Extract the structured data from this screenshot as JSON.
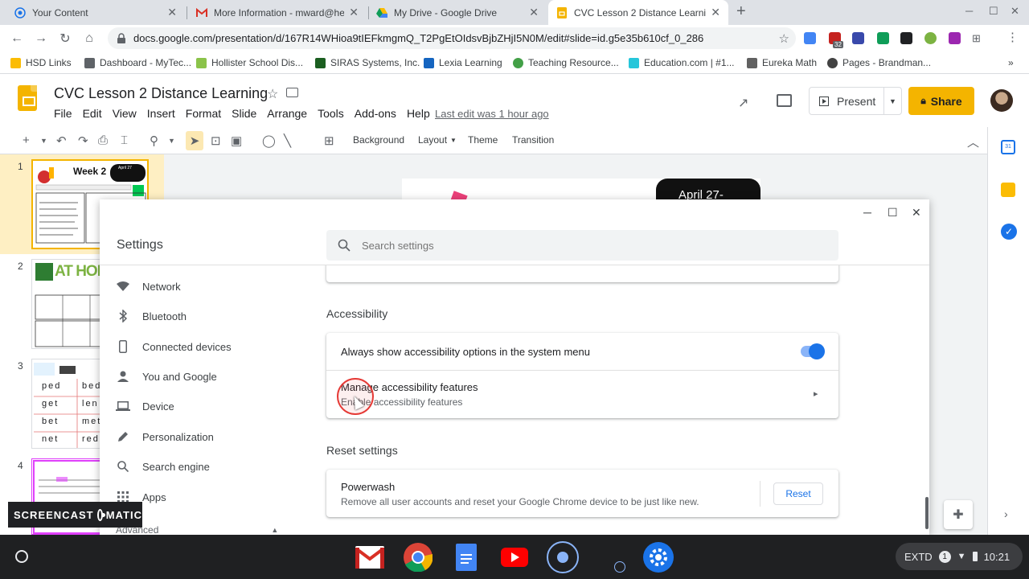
{
  "browser": {
    "tabs": [
      {
        "title": "Your Content",
        "icon": "screencast-icon"
      },
      {
        "title": "More Information - mward@hes",
        "icon": "gmail-icon"
      },
      {
        "title": "My Drive - Google Drive",
        "icon": "drive-icon"
      },
      {
        "title": "CVC Lesson 2 Distance Learning",
        "icon": "slides-icon",
        "active": true
      }
    ],
    "url": "docs.google.com/presentation/d/167R14WHioa9tIEFkmgmQ_T2PgEtOIdsvBjbZHjI5N0M/edit#slide=id.g5e35b610cf_0_286",
    "extension_badge": "32",
    "bookmarks": [
      "HSD Links",
      "Dashboard - MyTec...",
      "Hollister School Dis...",
      "SIRAS Systems, Inc.",
      "Lexia Learning",
      "Teaching Resource...",
      "Education.com | #1...",
      "Eureka Math",
      "Pages - Brandman..."
    ],
    "more_bookmarks": "»"
  },
  "slides": {
    "title": "CVC Lesson 2 Distance Learning",
    "menu": [
      "File",
      "Edit",
      "View",
      "Insert",
      "Format",
      "Slide",
      "Arrange",
      "Tools",
      "Add-ons",
      "Help"
    ],
    "last_edit": "Last edit was 1 hour ago",
    "present_label": "Present",
    "share_label": "Share",
    "toolbar": {
      "background": "Background",
      "layout": "Layout",
      "theme": "Theme",
      "transition": "Transition"
    },
    "slide_numbers": [
      "1",
      "2",
      "3",
      "4"
    ],
    "thumb1_title": "Week 2",
    "thumb1_date": "April 27",
    "thumb2_title": "AT HOM",
    "thumb3_words": [
      "ped",
      "bed",
      "get",
      "len",
      "bet",
      "met",
      "net",
      "red"
    ],
    "canvas_date": "April 27-",
    "side_badge": "31"
  },
  "settings": {
    "title": "Settings",
    "search_placeholder": "Search settings",
    "nav": [
      {
        "label": "Network",
        "icon": "wifi-icon"
      },
      {
        "label": "Bluetooth",
        "icon": "bluetooth-icon"
      },
      {
        "label": "Connected devices",
        "icon": "phone-icon"
      },
      {
        "label": "You and Google",
        "icon": "person-icon"
      },
      {
        "label": "Device",
        "icon": "laptop-icon"
      },
      {
        "label": "Personalization",
        "icon": "pencil-icon"
      },
      {
        "label": "Search engine",
        "icon": "search-icon"
      },
      {
        "label": "Apps",
        "icon": "apps-grid-icon"
      }
    ],
    "advanced_label": "Advanced",
    "accessibility": {
      "heading": "Accessibility",
      "always_show_label": "Always show accessibility options in the system menu",
      "always_show_enabled": true,
      "manage_label": "Manage accessibility features",
      "manage_sub": "Enable accessibility features"
    },
    "reset": {
      "heading": "Reset settings",
      "powerwash_label": "Powerwash",
      "powerwash_sub": "Remove all user accounts and reset your Google Chrome device to be just like new.",
      "reset_button": "Reset"
    }
  },
  "watermark": {
    "left": "SCREENCAST",
    "right": "MATIC"
  },
  "shelf": {
    "apps": [
      "gmail-icon",
      "chrome-icon",
      "docs-icon",
      "youtube-icon",
      "screencast-record-icon",
      "settings-icon"
    ],
    "status_label": "EXTD",
    "notification_count": "1",
    "time": "10:21"
  },
  "colors": {
    "accent": "#1a73e8",
    "slides_yellow": "#f4b400",
    "shelf": "#1f2022"
  }
}
